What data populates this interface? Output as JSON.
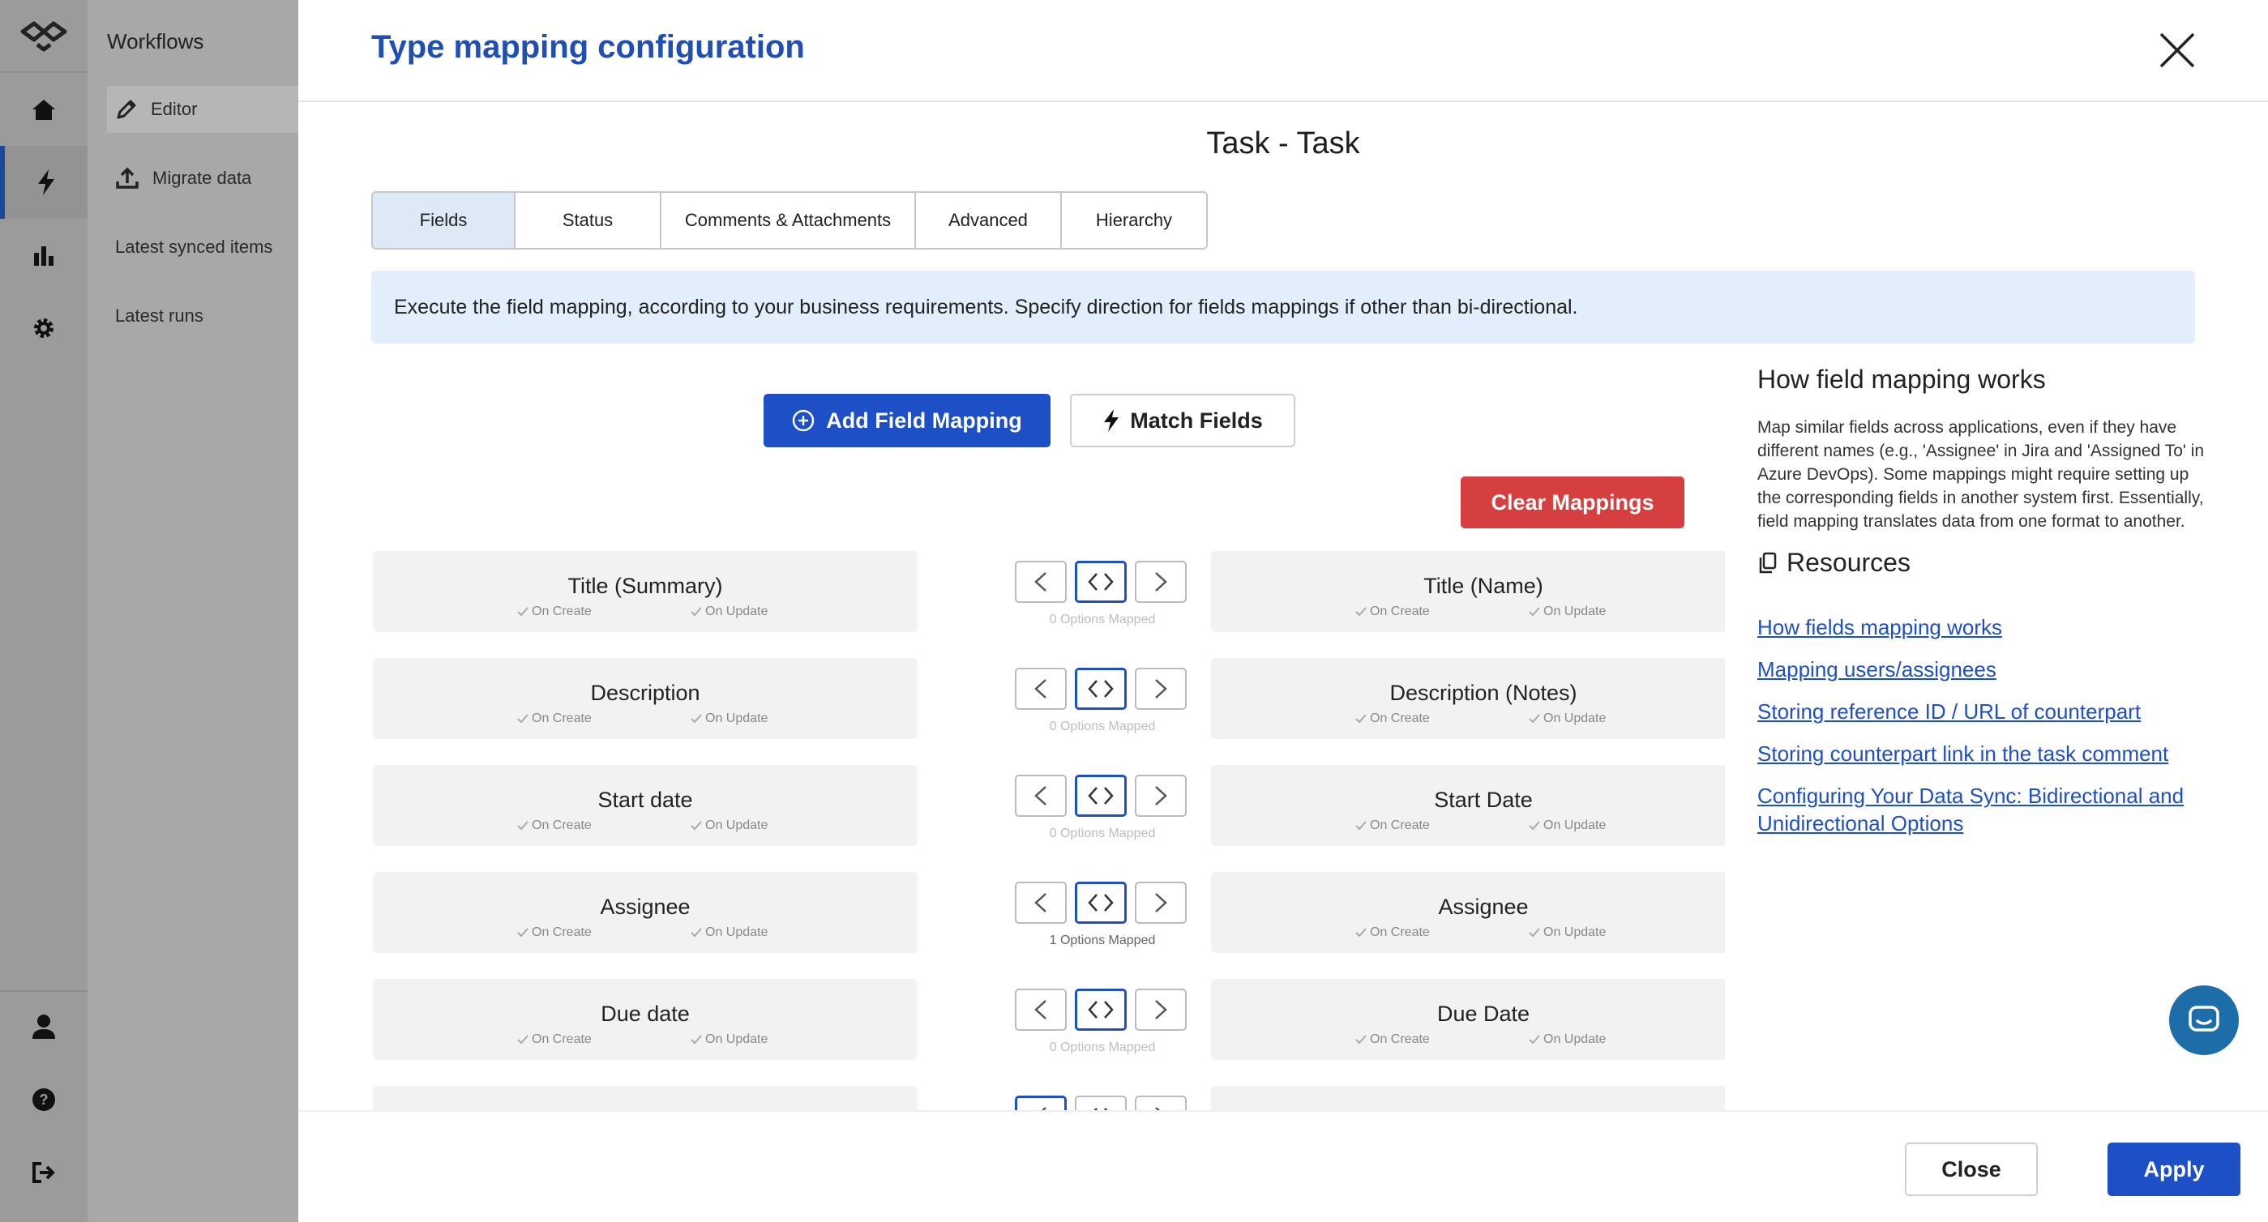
{
  "nav": {
    "section_title": "Workflows",
    "items": [
      {
        "label": "Editor"
      },
      {
        "label": "Migrate data"
      },
      {
        "label": "Latest synced items"
      },
      {
        "label": "Latest runs"
      }
    ]
  },
  "modal": {
    "title": "Type mapping configuration",
    "subtitle": "Task - Task",
    "tabs": [
      {
        "label": "Fields",
        "active": true
      },
      {
        "label": "Status"
      },
      {
        "label": "Comments & Attachments"
      },
      {
        "label": "Advanced"
      },
      {
        "label": "Hierarchy"
      }
    ],
    "banner": "Execute the field mapping, according to your business requirements. Specify direction for fields mappings if other than bi-directional.",
    "add_button": "Add Field Mapping",
    "match_button": "Match Fields",
    "clear_button": "Clear Mappings",
    "on_create": "On Create",
    "on_update": "On Update",
    "rows": [
      {
        "left": "Title (Summary)",
        "right": "Title (Name)",
        "options": "0 Options Mapped",
        "has_options": false
      },
      {
        "left": "Description",
        "right": "Description (Notes)",
        "options": "0 Options Mapped",
        "has_options": false
      },
      {
        "left": "Start date",
        "right": "Start Date",
        "options": "0 Options Mapped",
        "has_options": false
      },
      {
        "left": "Assignee",
        "right": "Assignee",
        "options": "1 Options Mapped",
        "has_options": true
      },
      {
        "left": "Due date",
        "right": "Due Date",
        "options": "0 Options Mapped",
        "has_options": false
      }
    ],
    "side": {
      "title": "How field mapping works",
      "text": "Map similar fields across applications, even if they have different names (e.g., 'Assignee' in Jira and 'Assigned To' in Azure DevOps). Some mappings might require setting up the corresponding fields in another system first. Essentially, field mapping translates data from one format to another.",
      "resources_title": "Resources",
      "links": [
        {
          "label": "How fields mapping works"
        },
        {
          "label": "Mapping users/assignees"
        },
        {
          "label": "Storing reference ID / URL of counterpart"
        },
        {
          "label": "Storing counterpart link in the task comment"
        },
        {
          "label": "Configuring Your Data Sync: Bidirectional and Unidirectional Options"
        }
      ]
    },
    "footer": {
      "close": "Close",
      "apply": "Apply"
    }
  },
  "colors": {
    "primary": "#1d4fc6",
    "danger": "#d63f3f",
    "title": "#1f4fb4",
    "banner": "#e2eefb"
  }
}
